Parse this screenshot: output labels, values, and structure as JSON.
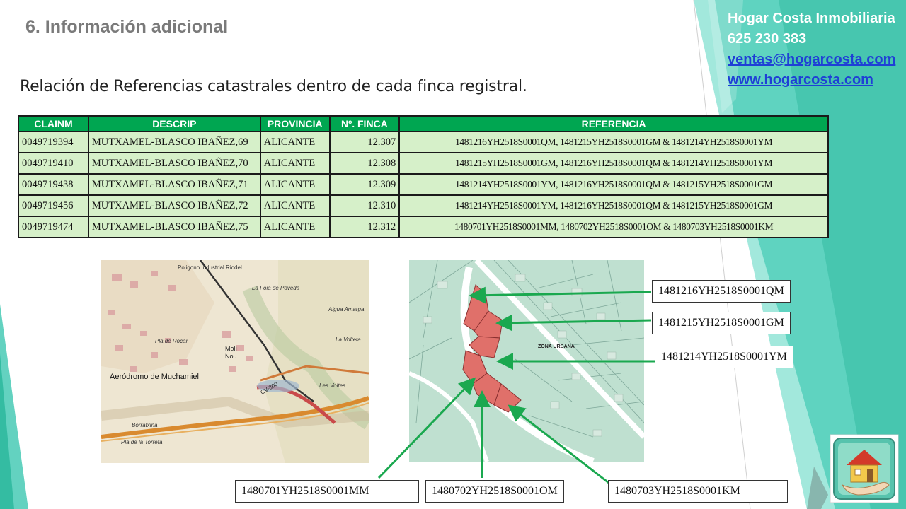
{
  "slide": {
    "title": "6. Información adicional",
    "subtitle": "Relación de Referencias catastrales dentro de cada finca registral."
  },
  "company": {
    "name": "Hogar Costa Inmobiliaria",
    "phone": "625 230 383",
    "email": "ventas@hogarcosta.com",
    "website": "www.hogarcosta.com"
  },
  "table": {
    "headers": [
      "CLAINM",
      "DESCRIP",
      "PROVINCIA",
      "Nº. FINCA",
      "REFERENCIA"
    ],
    "rows": [
      [
        "0049719394",
        "MUTXAMEL-BLASCO IBAÑEZ,69",
        "ALICANTE",
        "12.307",
        "1481216YH2518S0001QM, 1481215YH2518S0001GM & 1481214YH2518S0001YM"
      ],
      [
        "0049719410",
        "MUTXAMEL-BLASCO IBAÑEZ,70",
        "ALICANTE",
        "12.308",
        "1481215YH2518S0001GM, 1481216YH2518S0001QM & 1481214YH2518S0001YM"
      ],
      [
        "0049719438",
        "MUTXAMEL-BLASCO IBAÑEZ,71",
        "ALICANTE",
        "12.309",
        "1481214YH2518S0001YM, 1481216YH2518S0001QM & 1481215YH2518S0001GM"
      ],
      [
        "0049719456",
        "MUTXAMEL-BLASCO IBAÑEZ,72",
        "ALICANTE",
        "12.310",
        "1481214YH2518S0001YM, 1481216YH2518S0001QM & 1481215YH2518S0001GM"
      ],
      [
        "0049719474",
        "MUTXAMEL-BLASCO IBAÑEZ,75",
        "ALICANTE",
        "12.312",
        "1480701YH2518S0001MM, 1480702YH2518S0001OM & 1480703YH2518S0001KM"
      ]
    ]
  },
  "topo_map": {
    "labels": [
      "Poligono Industrial Riodel",
      "La Foia de Poveda",
      "Aigua Amarga",
      "Pla de Rocar",
      "Molí Nou",
      "La Volteta",
      "Aeródromo de Muchamiel",
      "CV-800",
      "Les Voltes",
      "Borratxina",
      "Pla de la Torreta"
    ]
  },
  "cadastral_map": {
    "zone_label": "ZONA URBANA"
  },
  "callouts": {
    "top": [
      "1481216YH2518S0001QM",
      "1481215YH2518S0001GM",
      "1481214YH2518S0001YM"
    ],
    "bottom": [
      "1480701YH2518S0001MM",
      "1480702YH2518S0001OM",
      "1480703YH2518S0001KM"
    ]
  },
  "colors": {
    "table_header": "#00a651",
    "table_row": "#d6f0c9",
    "accent_teal": "#3cc7b0",
    "arrow": "#1aa84f",
    "parcel": "#e0706a",
    "link": "#1f3fd6"
  },
  "icons": [
    "house-hand-logo-icon"
  ]
}
